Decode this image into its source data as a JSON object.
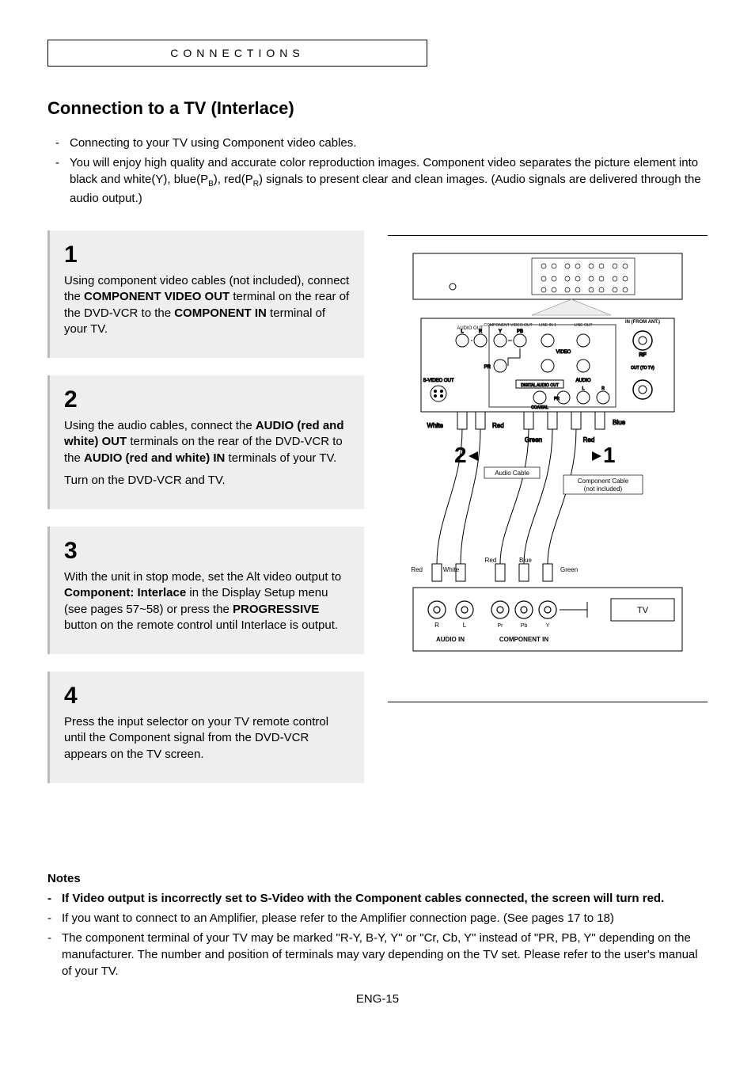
{
  "section_tab": "CONNECTIONS",
  "heading": "Connection to a TV (Interlace)",
  "intro": {
    "item1": "Connecting to your TV using Component video cables.",
    "item2_a": "You will enjoy high quality and accurate color reproduction images. Component video separates the picture element into black and white(Y), blue(P",
    "item2_sub1": "B",
    "item2_b": "), red(P",
    "item2_sub2": "R",
    "item2_c": ") signals to present clear and clean images. (Audio signals are delivered through the audio output.)"
  },
  "steps": {
    "s1": {
      "num": "1",
      "t1": "Using component video cables (not included), connect the ",
      "b1": "COMPONENT VIDEO OUT",
      "t2": " terminal on the rear of the DVD-VCR to the ",
      "b2": "COMPONENT IN",
      "t3": " terminal of your TV."
    },
    "s2": {
      "num": "2",
      "t1": "Using the audio cables, connect the ",
      "b1": "AUDIO (red and white) OUT",
      "t2": " terminals on the rear of the DVD-VCR to the ",
      "b2": "AUDIO (red and white) IN",
      "t3": " terminals of your TV.",
      "p2": "Turn on the DVD-VCR and TV."
    },
    "s3": {
      "num": "3",
      "t1": "With the unit in stop mode, set the Alt video output to ",
      "b1": "Component: Interlace",
      "t2": " in the Display Setup menu (see pages 57~58) or press the ",
      "b2": "PROGRESSIVE",
      "t3": " button on the remote control until Interlace is output."
    },
    "s4": {
      "num": "4",
      "t1": "Press the input selector on your TV remote control until the Component signal from the DVD-VCR appears on the TV screen."
    }
  },
  "diagram": {
    "top_labels": {
      "audio_out": "AUDIO OUT",
      "component_video_out": "COMPONENT VIDEO OUT",
      "line_in1": "LINE IN 1",
      "line_out": "LINE OUT",
      "in_from_ant": "IN (FROM ANT.)",
      "video": "VIDEO",
      "svideo_out": "S-VIDEO OUT",
      "digital_audio_out": "DIGITAL AUDIO OUT",
      "coaxial": "COAXIAL",
      "audio": "AUDIO",
      "rf": "RF",
      "out_to_tv": "OUT (TO TV)",
      "l": "L",
      "r": "R",
      "y": "Y",
      "pb": "PB",
      "pr": "PR"
    },
    "cable_labels": {
      "white": "White",
      "red": "Red",
      "green": "Green",
      "blue": "Blue",
      "audio_cable": "Audio Cable",
      "component_cable": "Component Cable",
      "not_included": "(not included)"
    },
    "step_badges": {
      "two": "2",
      "one": "1"
    },
    "tv_panel": {
      "tv": "TV",
      "audio_in": "AUDIO IN",
      "component_in": "COMPONENT IN",
      "r_circ": "R",
      "l_circ": "L",
      "pr": "Pr",
      "pb": "Pb",
      "y": "Y"
    }
  },
  "notes": {
    "title": "Notes",
    "n1": "If Video output is incorrectly set to S-Video with the Component cables connected, the screen will turn red.",
    "n2": "If you want to connect to an Amplifier, please refer to the Amplifier connection page. (See pages 17 to 18)",
    "n3": "The component terminal of your TV may be marked \"R-Y, B-Y, Y\" or \"Cr, Cb, Y\" instead of \"PR, PB, Y\" depending on the manufacturer. The number and position of terminals may vary depending on the TV set. Please refer to the user's manual of your TV."
  },
  "page_num": "ENG-15"
}
